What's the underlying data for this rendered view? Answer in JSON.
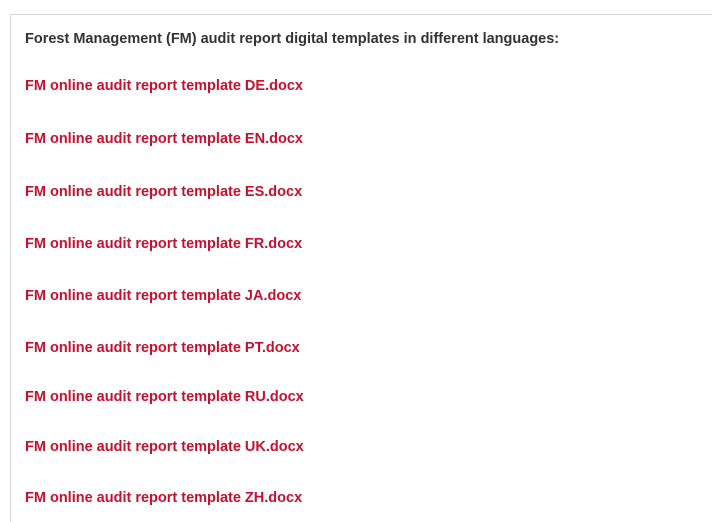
{
  "section": {
    "heading": "Forest Management (FM) audit report digital templates in different languages:",
    "link_color": "#c8102e",
    "files": [
      {
        "label": "FM online audit report template DE.docx"
      },
      {
        "label": "FM online audit report template EN.docx"
      },
      {
        "label": "FM online audit report template ES.docx"
      },
      {
        "label": "FM online audit report template FR.docx"
      },
      {
        "label": "FM online audit report template JA.docx"
      },
      {
        "label": "FM online audit report template PT.docx"
      },
      {
        "label": "FM online audit report template RU.docx"
      },
      {
        "label": "FM online audit report template UK.docx"
      },
      {
        "label": "FM online audit report template ZH.docx"
      }
    ]
  }
}
